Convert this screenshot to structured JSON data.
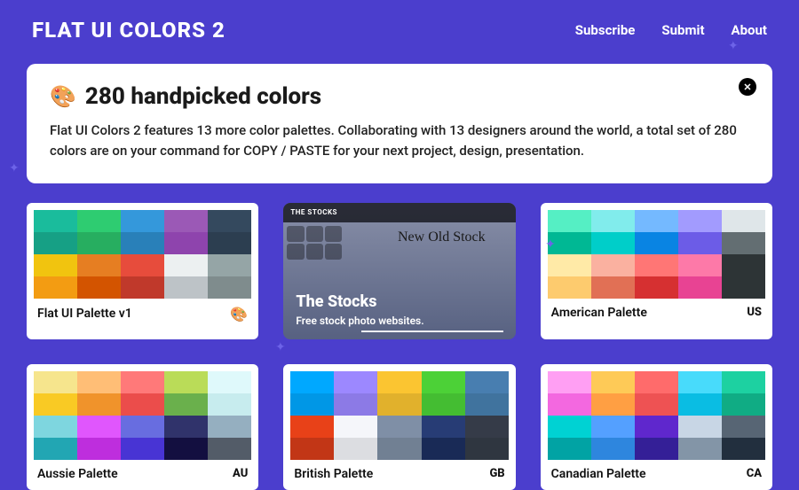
{
  "header": {
    "logo": "FLAT UI COLORS 2",
    "nav": [
      "Subscribe",
      "Submit",
      "About"
    ]
  },
  "banner": {
    "icon": "🎨",
    "title": "280 handpicked colors",
    "desc": "Flat UI Colors 2 features 13 more color palettes. Collaborating with 13 designers around the world, a total set of 280 colors are on your command for COPY / PASTE for your next project, design, presentation."
  },
  "feature": {
    "bar": "THE STOCKS",
    "script": "New Old Stock",
    "title": "The Stocks",
    "sub": "Free stock photo websites."
  },
  "palettes": [
    {
      "name": "Flat UI Palette v1",
      "icon": "🎨",
      "colors": [
        "#1abc9c",
        "#2ecc71",
        "#3498db",
        "#9b59b6",
        "#34495e",
        "#16a085",
        "#27ae60",
        "#2980b9",
        "#8e44ad",
        "#2c3e50",
        "#f1c40f",
        "#e67e22",
        "#e74c3c",
        "#ecf0f1",
        "#95a5a6",
        "#f39c12",
        "#d35400",
        "#c0392b",
        "#bdc3c7",
        "#7f8c8d"
      ]
    },
    {
      "name": "American Palette",
      "code": "US",
      "colors": [
        "#55efc4",
        "#81ecec",
        "#74b9ff",
        "#a29bfe",
        "#dfe6e9",
        "#00b894",
        "#00cec9",
        "#0984e3",
        "#6c5ce7",
        "#636e72",
        "#ffeaa7",
        "#fab1a0",
        "#ff7675",
        "#fd79a8",
        "#2d3436",
        "#fdcb6e",
        "#e17055",
        "#d63031",
        "#e84393",
        "#2d3436"
      ]
    },
    {
      "name": "Aussie Palette",
      "code": "AU",
      "colors": [
        "#f6e58d",
        "#ffbe76",
        "#ff7979",
        "#badc58",
        "#dff9fb",
        "#f9ca24",
        "#f0932b",
        "#eb4d4b",
        "#6ab04c",
        "#c7ecee",
        "#7ed6df",
        "#e056fd",
        "#686de0",
        "#30336b",
        "#95afc0",
        "#22a6b3",
        "#be2edd",
        "#4834d4",
        "#130f40",
        "#535c68"
      ]
    },
    {
      "name": "British Palette",
      "code": "GB",
      "colors": [
        "#00a8ff",
        "#9c88ff",
        "#fbc531",
        "#4cd137",
        "#487eb0",
        "#0097e6",
        "#8c7ae6",
        "#e1b12c",
        "#44bd32",
        "#40739e",
        "#e84118",
        "#f5f6fa",
        "#7f8fa6",
        "#273c75",
        "#353b48",
        "#c23616",
        "#dcdde1",
        "#718093",
        "#192a56",
        "#2f3640"
      ]
    },
    {
      "name": "Canadian Palette",
      "code": "CA",
      "colors": [
        "#ff9ff3",
        "#feca57",
        "#ff6b6b",
        "#48dbfb",
        "#1dd1a1",
        "#f368e0",
        "#ff9f43",
        "#ee5253",
        "#0abde3",
        "#10ac84",
        "#00d2d3",
        "#54a0ff",
        "#5f27cd",
        "#c8d6e5",
        "#576574",
        "#01a3a4",
        "#2e86de",
        "#341f97",
        "#8395a7",
        "#222f3e"
      ]
    }
  ]
}
